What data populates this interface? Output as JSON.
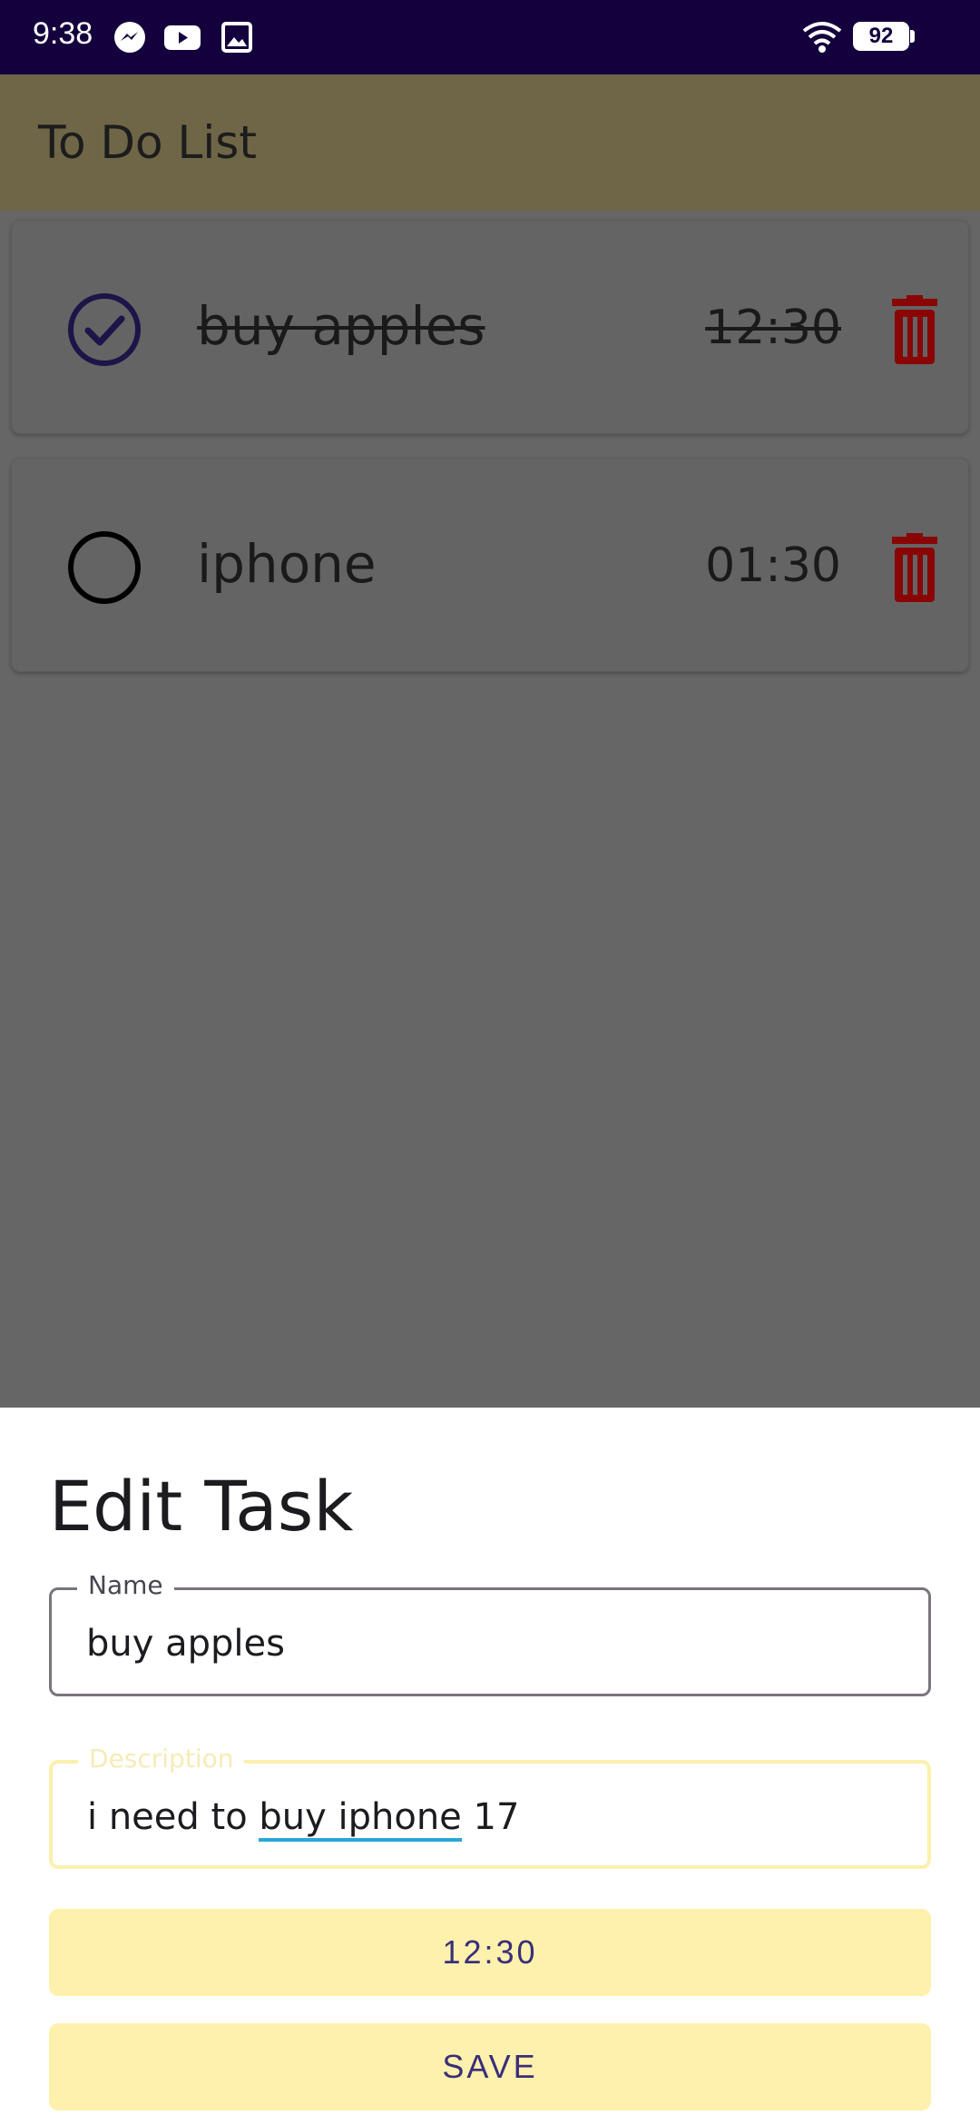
{
  "status_bar": {
    "time": "9:38",
    "notification_icons": [
      "messenger-icon",
      "youtube-icon",
      "gallery-icon"
    ],
    "wifi_icon": "wifi-icon",
    "battery": "92"
  },
  "app_bar": {
    "title": "To Do List",
    "color": "#6e6647"
  },
  "tasks": [
    {
      "name": "buy apples",
      "time": "12:30",
      "completed": true
    },
    {
      "name": "iphone",
      "time": "01:30",
      "completed": false
    }
  ],
  "edit_sheet": {
    "title": "Edit Task",
    "name_label": "Name",
    "name_value": "buy apples",
    "description_label": "Description",
    "description_prefix": "i need to ",
    "description_underlined": "buy iphone",
    "description_suffix": " 17",
    "time_button": "12:30",
    "save_button": "SAVE"
  },
  "colors": {
    "status_bar": "#14003d",
    "accent_button": "#fef1ad",
    "button_text": "#3a2e7a",
    "check_color": "#1c1548",
    "delete_red": "#8a0606"
  }
}
